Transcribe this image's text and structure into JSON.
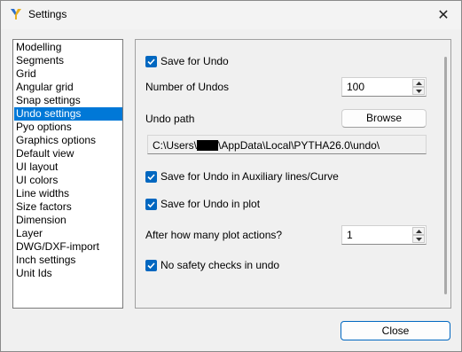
{
  "window": {
    "title": "Settings",
    "close_glyph": "✕",
    "icon": "pytha-app-icon"
  },
  "sidebar": {
    "items": [
      {
        "label": "Modelling",
        "selected": false
      },
      {
        "label": "Segments",
        "selected": false
      },
      {
        "label": "Grid",
        "selected": false
      },
      {
        "label": "Angular grid",
        "selected": false
      },
      {
        "label": "Snap settings",
        "selected": false
      },
      {
        "label": "Undo settings",
        "selected": true
      },
      {
        "label": "Pyo options",
        "selected": false
      },
      {
        "label": "Graphics options",
        "selected": false
      },
      {
        "label": "Default view",
        "selected": false
      },
      {
        "label": "UI layout",
        "selected": false
      },
      {
        "label": "UI colors",
        "selected": false
      },
      {
        "label": "Line widths",
        "selected": false
      },
      {
        "label": "Size factors",
        "selected": false
      },
      {
        "label": "Dimension",
        "selected": false
      },
      {
        "label": "Layer",
        "selected": false
      },
      {
        "label": "DWG/DXF-import",
        "selected": false
      },
      {
        "label": "Inch settings",
        "selected": false
      },
      {
        "label": "Unit Ids",
        "selected": false
      }
    ]
  },
  "panel": {
    "save_for_undo": {
      "label": "Save for Undo",
      "checked": true
    },
    "number_of_undos": {
      "label": "Number of Undos",
      "value": "100"
    },
    "undo_path": {
      "label": "Undo path",
      "browse_label": "Browse",
      "value_prefix": "C:\\Users\\",
      "value_suffix": "\\AppData\\Local\\PYTHA26.0\\undo\\"
    },
    "save_aux": {
      "label": "Save for Undo in Auxiliary lines/Curve",
      "checked": true
    },
    "save_plot": {
      "label": "Save for Undo in plot",
      "checked": true
    },
    "plot_actions": {
      "label": "After how many plot actions?",
      "value": "1"
    },
    "no_safety": {
      "label": "No safety checks in undo",
      "checked": true
    }
  },
  "footer": {
    "close_label": "Close"
  },
  "colors": {
    "accent": "#0067c0",
    "selection": "#0078d7"
  }
}
